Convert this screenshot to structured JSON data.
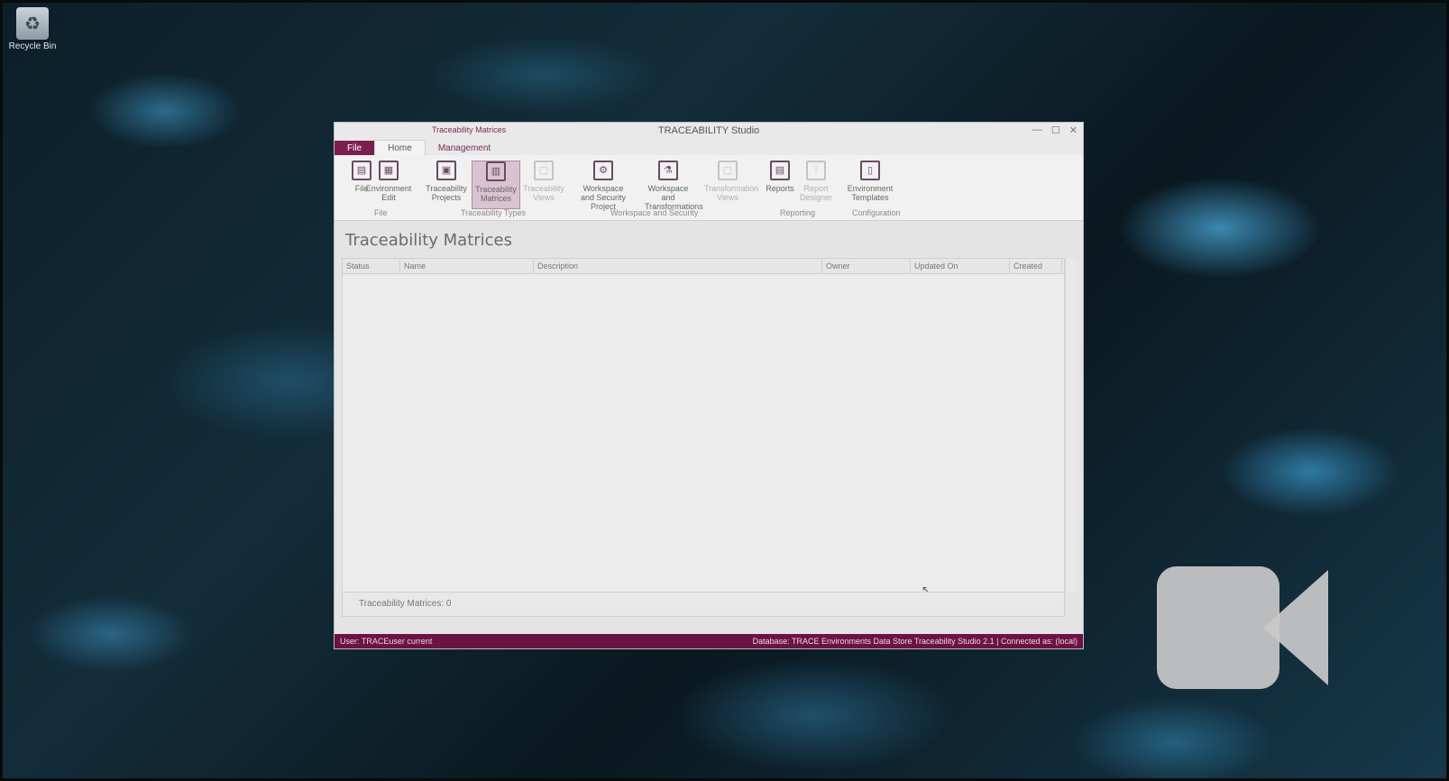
{
  "desktop": {
    "icon_label": "Recycle Bin"
  },
  "window": {
    "title": "TRACEABILITY Studio",
    "context_tab_group": "Traceability Matrices",
    "controls": [
      "—",
      "☐",
      "✕"
    ]
  },
  "tabs": {
    "file": "File",
    "home": "Home",
    "management": "Management"
  },
  "ribbon": {
    "buttons": [
      {
        "label": "File",
        "icon": "file-icon"
      },
      {
        "label": "Environment Edit",
        "icon": "environment-icon"
      },
      {
        "label": "Traceability Projects",
        "icon": "projects-icon"
      },
      {
        "label": "Traceability Matrices",
        "icon": "matrix-icon"
      },
      {
        "label": "Traceability Views",
        "icon": "views-icon"
      },
      {
        "label": "Workspace and Security Project",
        "icon": "workspace-icon"
      },
      {
        "label": "Workspace and Transformations",
        "icon": "transform-icon"
      },
      {
        "label": "Transformation Views",
        "icon": "tview-icon"
      },
      {
        "label": "Reports",
        "icon": "report-icon"
      },
      {
        "label": "Report Designer",
        "icon": "designer-icon"
      },
      {
        "label": "Environment Templates",
        "icon": "template-icon"
      }
    ],
    "groups": [
      "File",
      "Traceability Types",
      "Workspace and Security",
      "Reporting",
      "Configuration"
    ]
  },
  "page": {
    "title": "Traceability Matrices",
    "columns": [
      "Status",
      "Name",
      "Description",
      "Owner",
      "Updated On",
      "Created"
    ],
    "footer_text": "Traceability Matrices: 0"
  },
  "statusbar": {
    "left": "User: TRACEuser current",
    "right": "Database: TRACE Environments Data Store Traceability Studio 2.1 | Connected as: (local)"
  }
}
